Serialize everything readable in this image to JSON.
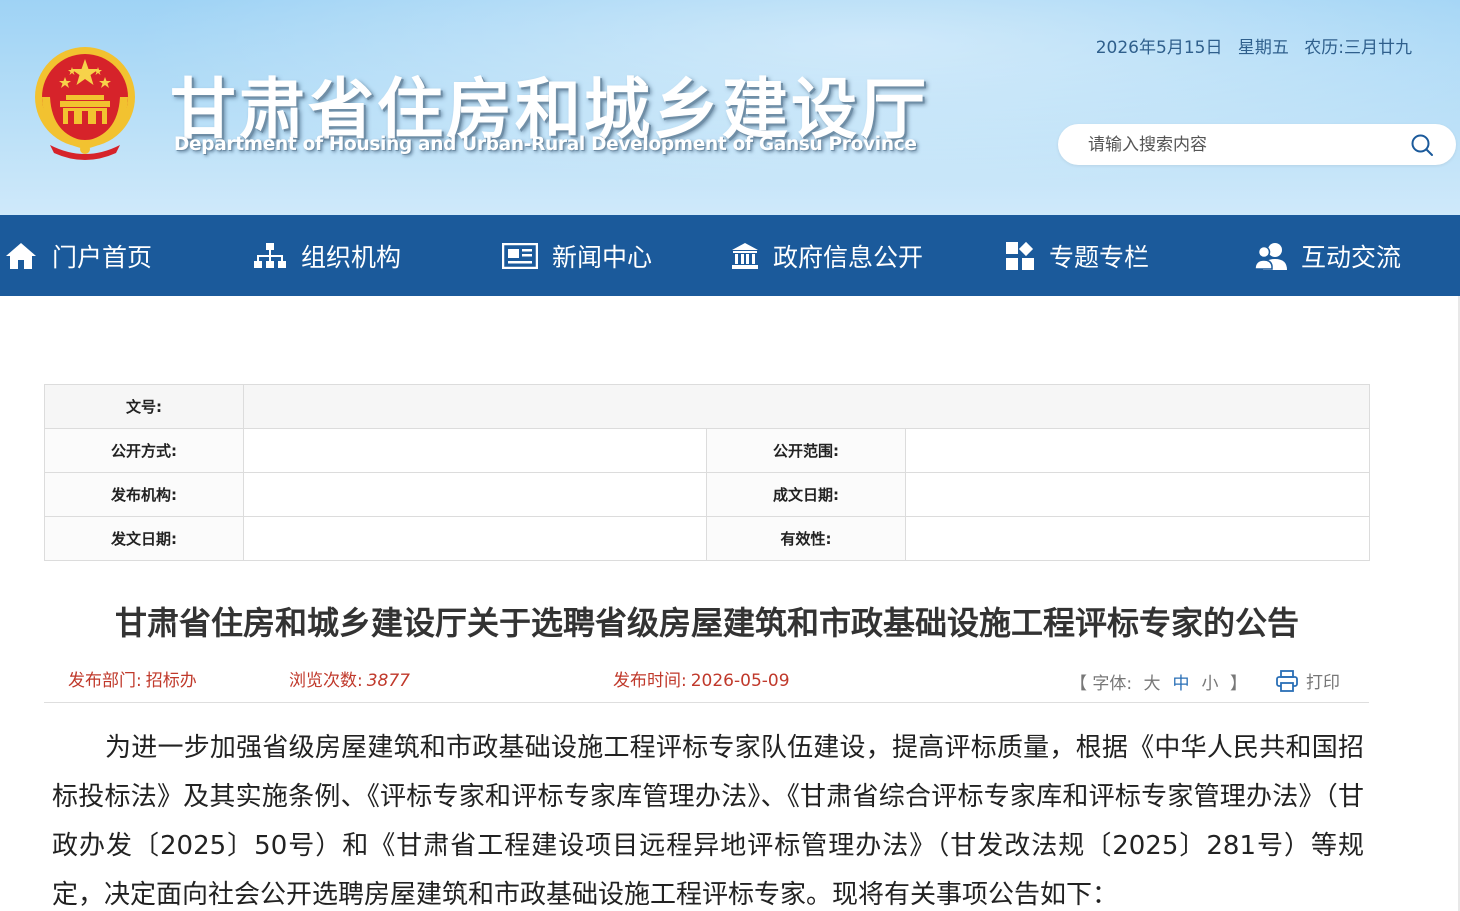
{
  "header": {
    "title": "甘肃省住房和城乡建设厅",
    "subtitle": "Department of Housing and Urban-Rural Development of Gansu Province",
    "date": "2026年5月15日",
    "weekday": "星期五",
    "lunar": "农历:三月廿九",
    "search_placeholder": "请输入搜索内容",
    "emblem_icon": "national-emblem-icon",
    "search_icon": "search-icon"
  },
  "nav": {
    "items": [
      {
        "label": "门户首页",
        "icon": "home-icon"
      },
      {
        "label": "组织机构",
        "icon": "org-chart-icon"
      },
      {
        "label": "新闻中心",
        "icon": "newspaper-icon"
      },
      {
        "label": "政府信息公开",
        "icon": "government-building-icon"
      },
      {
        "label": "专题专栏",
        "icon": "grid-icon"
      },
      {
        "label": "互动交流",
        "icon": "users-icon"
      }
    ]
  },
  "meta": {
    "doc_no_label": "文号:",
    "doc_no_value": "",
    "open_mode_label": "公开方式:",
    "open_mode_value": "",
    "open_scope_label": "公开范围:",
    "open_scope_value": "",
    "issuer_label": "发布机构:",
    "issuer_value": "",
    "written_date_label": "成文日期:",
    "written_date_value": "",
    "issue_date_label": "发文日期:",
    "issue_date_value": "",
    "validity_label": "有效性:",
    "validity_value": ""
  },
  "article": {
    "title": "甘肃省住房和城乡建设厅关于选聘省级房屋建筑和市政基础设施工程评标专家的公告",
    "dept_label": "发布部门:",
    "dept_value": "招标办",
    "views_label": "浏览次数:",
    "views_value": "3877",
    "time_label": "发布时间:",
    "time_value": "2026-05-09",
    "font_label": "字体:",
    "font_open": "【",
    "font_close": "】",
    "font_large": "大",
    "font_medium": "中",
    "font_small": "小",
    "print_label": "打印",
    "print_icon": "printer-icon",
    "body": "为进一步加强省级房屋建筑和市政基础设施工程评标专家队伍建设，提高评标质量，根据《中华人民共和国招标投标法》及其实施条例、《评标专家和评标专家库管理办法》、《甘肃省综合评标专家库和评标专家管理办法》（甘政办发〔2025〕50号）和《甘肃省工程建设项目远程异地评标管理办法》（甘发改法规〔2025〕281号）等规定，决定面向社会公开选聘房屋建筑和市政基础设施工程评标专家。现将有关事项公告如下："
  },
  "colors": {
    "nav_bg": "#1b5a9b",
    "header_bg": "#b4ddf7",
    "info_red": "#c0392b",
    "link_blue": "#2a6fb6"
  }
}
